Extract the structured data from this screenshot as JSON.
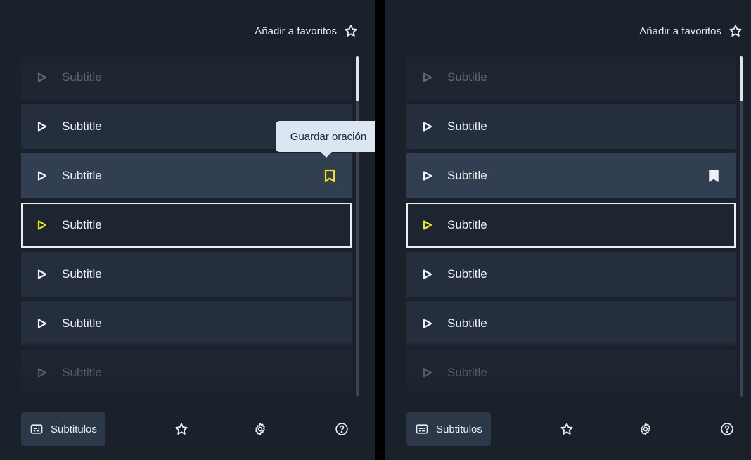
{
  "favorites": {
    "label": "Añadir a favoritos",
    "icon": "star-outline-icon"
  },
  "subtitles": [
    {
      "text": "Subtitle",
      "state": "faded"
    },
    {
      "text": "Subtitle",
      "state": "normal"
    },
    {
      "text": "Subtitle",
      "state": "hover"
    },
    {
      "text": "Subtitle",
      "state": "active"
    },
    {
      "text": "Subtitle",
      "state": "normal"
    },
    {
      "text": "Subtitle",
      "state": "normal"
    },
    {
      "text": "Subtitle",
      "state": "faded"
    }
  ],
  "tooltip": {
    "text": "Guardar oración"
  },
  "nav": {
    "subtitles_label": "Subtitulos",
    "icons": [
      "subtitles-icon",
      "star-outline-icon",
      "gear-icon",
      "help-icon"
    ]
  },
  "colors": {
    "background": "#1b212b",
    "row": "#242e3d",
    "row_hover": "#323e51",
    "accent_yellow": "#f2e21b",
    "text": "#f0f4f8"
  }
}
